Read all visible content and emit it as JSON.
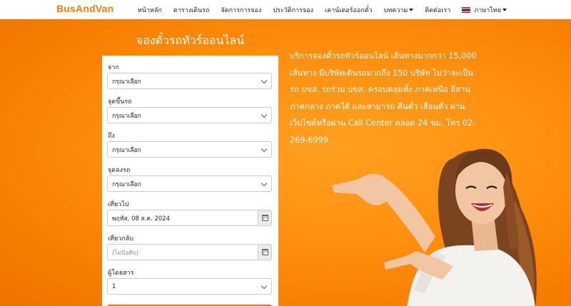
{
  "brand": "BusAndVan",
  "nav": {
    "items": [
      "หน้าหลัก",
      "ตารางเดินรถ",
      "จัดการการจอง",
      "ประวัติการจอง",
      "เคาน์เตอร์ออกตั๋ว",
      "บทความ",
      "ติดต่อเรา"
    ],
    "language": "ภาษาไทย"
  },
  "form": {
    "title": "จองตั๋วรถทัวร์ออนไลน์",
    "from_label": "จาก",
    "from_value": "กรุณาเลือก",
    "pickup_label": "จุดขึ้นรถ",
    "pickup_value": "กรุณาเลือก",
    "to_label": "ถึง",
    "to_value": "กรุณาเลือก",
    "dropoff_label": "จุดลงรถ",
    "dropoff_value": "กรุณาเลือก",
    "depart_label": "เที่ยวไป",
    "depart_value": "พฤหัส, 08 ส.ค. 2024",
    "return_label": "เที่ยวกลับ",
    "return_placeholder": "(ไม่บังคับ)",
    "passengers_label": "ผู้โดยสาร",
    "passengers_value": "1"
  },
  "info": "บริการจองตั๋วรถทัวร์ออนไลน์ เส้นทางมากกว่า 15,000 เส้นทาง มีบริษัทเดินรถมากถึง 150 บริษัท ไม่ว่าจะเป็น รถ บขส. รถร่วม บขส. ครอบคลุมทั้ง ภาคเหนือ อีสาน ภาคกลาง ภาคใต้ และสามารถ คืนตั๋ว เลื่อนตั๋ว ผ่านเว็บไซต์หรือผ่าน Call Center ตลอด 24 ชม. โทร 02-269-6999",
  "colors": {
    "brand": "#ff7a00",
    "hero": "#ff9010"
  }
}
